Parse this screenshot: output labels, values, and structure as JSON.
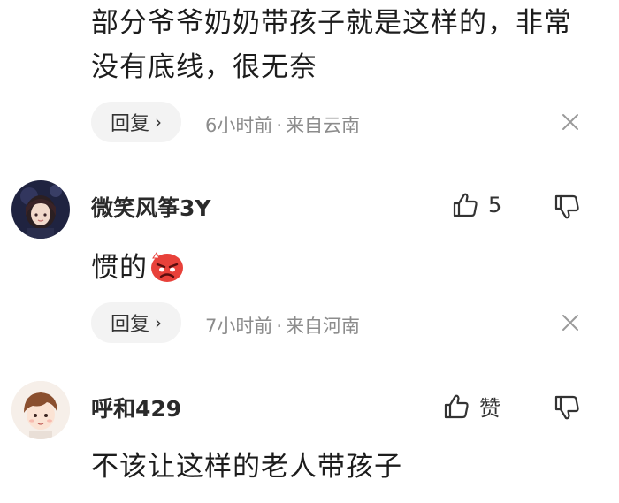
{
  "comments": [
    {
      "text_lines": [
        "部分爷爷奶奶带孩子就是这样的，非常",
        "没有底线，很无奈"
      ],
      "reply_label": "回复",
      "reply_chevron": "›",
      "time": "6小时前",
      "separator": "·",
      "location": "来自云南"
    },
    {
      "username": "微笑风筝3Y",
      "like_count": "5",
      "text": "惯的",
      "emoji": "angry-face-emoji",
      "reply_label": "回复",
      "reply_chevron": "›",
      "time": "7小时前",
      "separator": "·",
      "location": "来自河南"
    },
    {
      "username": "呼和429",
      "like_label": "赞",
      "text": "不该让这样的老人带孩子"
    }
  ],
  "icons": {
    "like": "thumbs-up-icon",
    "dislike": "thumbs-down-icon",
    "close": "close-icon"
  },
  "colors": {
    "meta_gray": "#8c8c8c",
    "reply_bg": "#f3f3f3",
    "emoji_red": "#e8413a"
  }
}
